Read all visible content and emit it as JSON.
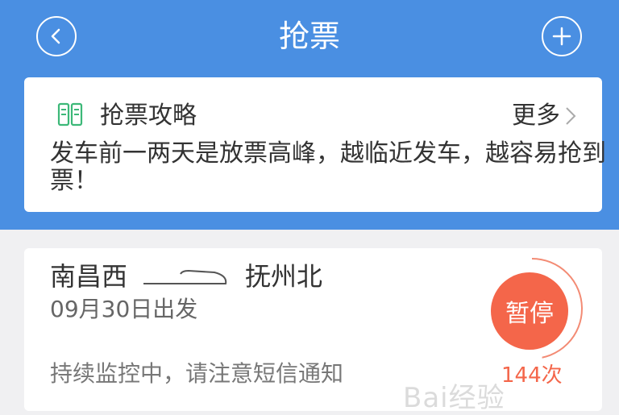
{
  "header": {
    "title": "抢票",
    "bg_color": "#4a8fe2"
  },
  "tips": {
    "title": "抢票攻略",
    "more_label": "更多",
    "text": "发车前一两天是放票高峰，越临近发车，越容易抢到票！"
  },
  "ticket": {
    "from": "南昌西",
    "to": "抚州北",
    "date": "09月30日出发",
    "status_text": "持续监控中，请注意短信通知",
    "pause_label": "暂停",
    "count": "144次",
    "accent_color": "#f4664a"
  },
  "watermark": {
    "text": "Bai经验"
  },
  "icons": [
    "back-arrow-icon",
    "plus-icon",
    "book-icon",
    "chevron-right-icon",
    "train-icon"
  ]
}
